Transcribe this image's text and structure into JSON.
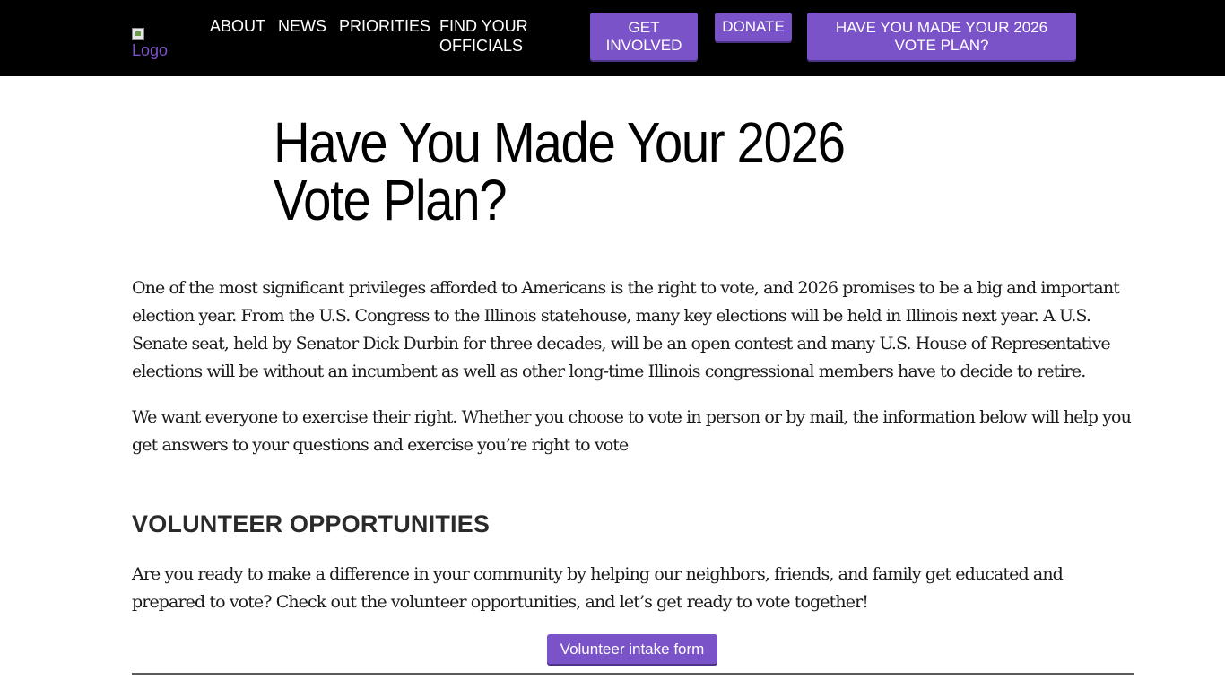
{
  "header": {
    "logo_alt": "Logo",
    "nav": {
      "about": "ABOUT",
      "news": "NEWS",
      "priorities": "PRIORITIES",
      "find_officials": "FIND YOUR OFFICIALS"
    },
    "buttons": {
      "get_involved": "GET INVOLVED",
      "donate": "DONATE",
      "vote_plan": "HAVE YOU MADE YOUR 2026 VOTE PLAN?"
    }
  },
  "main": {
    "title": "Have You Made Your 2026 Vote Plan?",
    "intro_paragraphs": [
      "One of the most significant privileges afforded to Americans is the right to vote, and 2026 promises to be a big and important election year. From the U.S. Congress to the Illinois statehouse, many key elections will be held in Illinois next year. A U.S. Senate seat, held by Senator Dick Durbin for three decades, will be an open contest and many U.S. House of Representative elections will be without an incumbent as well as other long-time Illinois congressional members have to decide to retire.",
      "We want everyone to exercise their right. Whether you choose to vote in person or by mail, the information below will help you get answers to your questions and exercise you’re right to vote"
    ],
    "volunteer": {
      "heading": "VOLUNTEER OPPORTUNITIES",
      "text": "Are you ready to make a difference in your community by helping our neighbors, friends, and family get educated and prepared to vote? Check out the volunteer opportunities, and let’s get ready to vote together!",
      "button": "Volunteer intake form"
    }
  },
  "colors": {
    "header_bg": "#000000",
    "accent": "#7b53c9",
    "text": "#1a1a1a"
  }
}
